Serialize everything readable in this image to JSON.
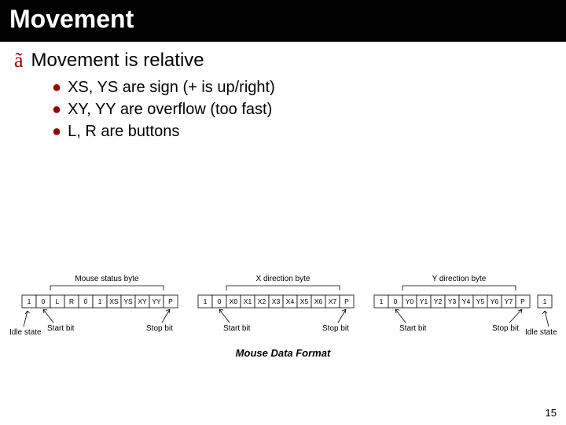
{
  "title": "Movement",
  "main_bullet": {
    "glyph": "ã",
    "text": "Movement is relative"
  },
  "sub_bullets": [
    "XS, YS are sign (+ is up/right)",
    "XY, YY are overflow (too fast)",
    "L, R are buttons"
  ],
  "diagram": {
    "caption": "Mouse Data Format",
    "groups": [
      {
        "label": "Mouse status byte",
        "bits": [
          "1",
          "0",
          "L",
          "R",
          "0",
          "1",
          "XS",
          "YS",
          "XY",
          "YY",
          "P"
        ]
      },
      {
        "label": "X direction byte",
        "bits": [
          "1",
          "0",
          "X0",
          "X1",
          "X2",
          "X3",
          "X4",
          "X5",
          "X6",
          "X7",
          "P"
        ]
      },
      {
        "label": "Y direction byte",
        "bits": [
          "1",
          "0",
          "Y0",
          "Y1",
          "Y2",
          "Y3",
          "Y4",
          "Y5",
          "Y6",
          "Y7",
          "P"
        ]
      }
    ],
    "trailing_bit": "1",
    "labels": {
      "idle": "Idle state",
      "start": "Start bit",
      "stop": "Stop bit"
    }
  },
  "page_number": "15"
}
